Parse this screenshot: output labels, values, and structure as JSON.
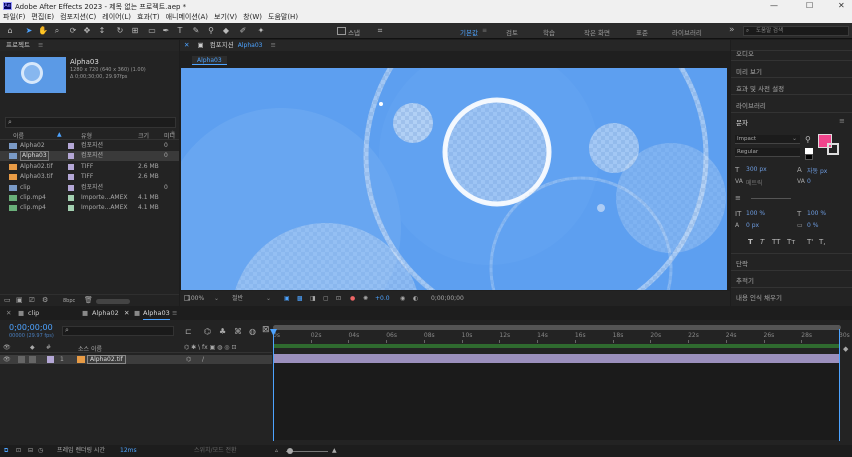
{
  "window": {
    "title": "Adobe After Effects 2023 - 제목 없는 프로젝트.aep *",
    "app_icon": "Ae"
  },
  "menu": [
    "파일(F)",
    "편집(E)",
    "컴포지션(C)",
    "레이어(L)",
    "효과(T)",
    "애니메이션(A)",
    "보기(V)",
    "창(W)",
    "도움말(H)"
  ],
  "workspaces": [
    "기본값",
    "검토",
    "학습",
    "작은 화면",
    "표준",
    "라이브러리"
  ],
  "toolbar": {
    "snap_label": "스냅",
    "search_placeholder": "도움말 검색"
  },
  "project": {
    "title": "프로젝트",
    "selected": {
      "name": "Alpha03",
      "info1": "1280 x 720 (640 x 360) (1.00)",
      "info2": "Δ 0;00;30;00, 29.97fps"
    },
    "search_placeholder": "",
    "columns": [
      "이름",
      "유형",
      "크기",
      "미디"
    ],
    "items": [
      {
        "name": "Alpha02",
        "type": "컴포지션",
        "size": "",
        "extra": "",
        "color": "#b4a7d6"
      },
      {
        "name": "Alpha03",
        "type": "컴포지션",
        "size": "",
        "extra": "",
        "color": "#b4a7d6"
      },
      {
        "name": "Alpha02.tif",
        "type": "TIFF",
        "size": "2.6 MB",
        "extra": "",
        "color": "#b4a7d6"
      },
      {
        "name": "Alpha03.tif",
        "type": "TIFF",
        "size": "2.6 MB",
        "extra": "",
        "color": "#b4a7d6"
      },
      {
        "name": "clip",
        "type": "컴포지션",
        "size": "",
        "extra": "",
        "color": "#b4a7d6"
      },
      {
        "name": "clip.mp4",
        "type": "Importe...AMEX",
        "size": "4.1 MB",
        "extra": "",
        "color": "#a3cfb0"
      },
      {
        "name": "clip.mp4",
        "type": "Importe...AMEX",
        "size": "4.1 MB",
        "extra": "",
        "color": "#a3cfb0"
      }
    ],
    "bpc": "8bpc"
  },
  "composition": {
    "title": "컴포지션",
    "active": "Alpha03",
    "breadcrumb": "Alpha03",
    "zoom": "100%",
    "quality": "절반",
    "exposure": "+0.0",
    "timecode": "0;00;00;00"
  },
  "right_panels": [
    "오디오",
    "미리 보기",
    "효과 및 사전 설정",
    "라이브러리"
  ],
  "character": {
    "title": "문자",
    "font": "Impact",
    "style": "Regular",
    "size": "300 px",
    "leading": "자동 px",
    "kerning": "메트릭",
    "tracking": "0",
    "vscale": "100 %",
    "hscale": "100 %",
    "baseline": "0 px",
    "tsume": "0 %",
    "fill_color": "#f0458c",
    "styles": [
      "T",
      "T",
      "TT",
      "Tт",
      "T'",
      "T,"
    ]
  },
  "more_panels": [
    "단락",
    "추적기",
    "내용 인식 채우기"
  ],
  "timeline": {
    "tabs": [
      "clip",
      "Alpha02",
      "Alpha03"
    ],
    "active_tab": "Alpha03",
    "timecode": "0;00;00;00",
    "fps_note": "00000 (29.97 fps)",
    "col_source": "소스 이름",
    "layer": {
      "num": "1",
      "name": "Alpha02.tif"
    },
    "ruler": [
      "0s",
      "02s",
      "04s",
      "06s",
      "08s",
      "10s",
      "12s",
      "14s",
      "16s",
      "18s",
      "20s",
      "22s",
      "24s",
      "26s",
      "28s",
      "30s"
    ],
    "footer_label": "프레임 렌더링 시간",
    "footer_value": "12ms",
    "footer_mode": "스위치/모드 전환"
  }
}
